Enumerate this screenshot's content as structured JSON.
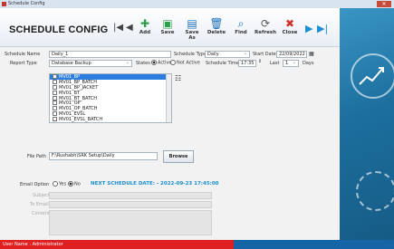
{
  "window": {
    "title": "Schedule Config"
  },
  "header": {
    "title": "SCHEDULE CONFIG"
  },
  "toolbar": {
    "add_label": "Add",
    "save_label": "Save",
    "save_as_label": "Save As",
    "delete_label": "Delete",
    "find_label": "Find",
    "refresh_label": "Refresh",
    "close_label": "Close"
  },
  "form": {
    "schedule_name_label": "Schedule Name",
    "schedule_name_value": "Daily_1",
    "schedule_type_label": "Schedule Type",
    "schedule_type_value": "Daily",
    "start_date_label": "Start Date",
    "start_date_value": "22/09/2022",
    "report_type_label": "Report Type",
    "report_type_value": "Database Backup",
    "states_label": "States",
    "active_label": "Active",
    "not_active_label": "Not Active",
    "schedule_time_label": "Schedule Time",
    "schedule_time_value": "17:35",
    "last_label": "Last",
    "last_value": "1",
    "days_label": "Days",
    "file_path_label": "File Path",
    "file_path_value": "F:\\Rushabh\\SRK Setup\\Daily",
    "browse_label": "Browse",
    "email_option_label": "Email Option",
    "yes_label": "Yes",
    "no_label": "No",
    "next_schedule": "NEXT SCHEDULE DATE: - 2022-09-23 17:45:00",
    "subject_label": "Subject",
    "to_email_label": "To Email",
    "content_label": "Content"
  },
  "report_list": [
    "MV01_BP",
    "MV01_BP_BATCH",
    "MV01_BP_JACKET",
    "MV01_BT",
    "MV01_BT_BATCH",
    "MV01_OP",
    "MV01_OP_BATCH",
    "MV01_EVSL",
    "MV01_EVSL_BATCH"
  ],
  "status": {
    "user": "User Name : Administrator"
  },
  "colors": {
    "accent": "#1a8fd1",
    "status_red": "#e02020",
    "status_blue": "#1565a6"
  }
}
